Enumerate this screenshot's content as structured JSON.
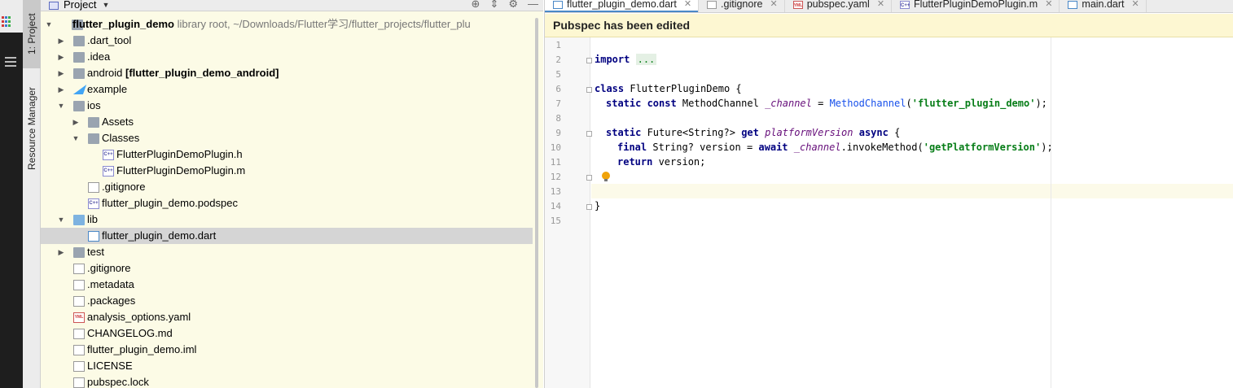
{
  "window": {
    "tool_tabs": {
      "project": "1: Project",
      "resource_manager": "Resource Manager"
    }
  },
  "project_panel": {
    "title": "Project",
    "tree": [
      {
        "label": "flutter_plugin_demo",
        "suffix": "library root, ~/Downloads/Flutter学习/flutter_projects/flutter_plu",
        "icon": "folder-icon",
        "bold": true
      },
      {
        "label": ".dart_tool",
        "icon": "folder-icon"
      },
      {
        "label": ".idea",
        "icon": "folder-icon"
      },
      {
        "label": "android",
        "suffix": "[flutter_plugin_demo_android]",
        "icon": "folder-icon"
      },
      {
        "label": "example",
        "icon": "flutter-icon"
      },
      {
        "label": "ios",
        "icon": "folder-icon"
      },
      {
        "label": "Assets",
        "icon": "folder-icon"
      },
      {
        "label": "Classes",
        "icon": "folder-icon"
      },
      {
        "label": "FlutterPluginDemoPlugin.h",
        "icon": "c-file-icon"
      },
      {
        "label": "FlutterPluginDemoPlugin.m",
        "icon": "c-file-icon"
      },
      {
        "label": ".gitignore",
        "icon": "file-icon"
      },
      {
        "label": "flutter_plugin_demo.podspec",
        "icon": "c-file-icon"
      },
      {
        "label": "lib",
        "icon": "folder-icon"
      },
      {
        "label": "flutter_plugin_demo.dart",
        "icon": "dart-file-icon"
      },
      {
        "label": "test",
        "icon": "folder-icon"
      },
      {
        "label": ".gitignore",
        "icon": "file-icon"
      },
      {
        "label": ".metadata",
        "icon": "file-icon"
      },
      {
        "label": ".packages",
        "icon": "file-icon"
      },
      {
        "label": "analysis_options.yaml",
        "icon": "yaml-file-icon"
      },
      {
        "label": "CHANGELOG.md",
        "icon": "file-icon"
      },
      {
        "label": "flutter_plugin_demo.iml",
        "icon": "file-icon"
      },
      {
        "label": "LICENSE",
        "icon": "file-icon"
      },
      {
        "label": "pubspec.lock",
        "icon": "file-icon"
      }
    ]
  },
  "editor": {
    "tabs": [
      {
        "label": "flutter_plugin_demo.dart",
        "icon": "dart-file-icon"
      },
      {
        "label": ".gitignore",
        "icon": "file-icon"
      },
      {
        "label": "pubspec.yaml",
        "icon": "yaml-file-icon"
      },
      {
        "label": "FlutterPluginDemoPlugin.m",
        "icon": "c-file-icon"
      },
      {
        "label": "main.dart",
        "icon": "dart-file-icon"
      }
    ],
    "banner": "Pubspec has been edited",
    "line_numbers": [
      "1",
      "2",
      "5",
      "6",
      "7",
      "8",
      "9",
      "10",
      "11",
      "12",
      "13",
      "14",
      "15"
    ],
    "code": {
      "l2_kw": "import",
      "l2_dots": "...",
      "l6_kw": "class",
      "l6_rest": " FlutterPluginDemo {",
      "l7_kw": "static const",
      "l7_type": " MethodChannel ",
      "l7_field": "_channel",
      "l7_eq": " = ",
      "l7_call": "MethodChannel",
      "l7_open": "(",
      "l7_str": "'flutter_plugin_demo'",
      "l7_close": ");",
      "l9_kw": "static",
      "l9_type": " Future<String?> ",
      "l9_kw2": "get",
      "l9_sp": " ",
      "l9_field": "platformVersion",
      "l9_sp2": " ",
      "l9_kw3": "async",
      "l9_brace": " {",
      "l10_kw": "final",
      "l10_type": " String? version = ",
      "l10_kw2": "await",
      "l10_sp": " ",
      "l10_field": "_channel",
      "l10_call": ".invokeMethod(",
      "l10_str": "'getPlatformVersion'",
      "l10_close": ");",
      "l11_kw": "return",
      "l11_rest": " version;",
      "l14": "}"
    }
  }
}
